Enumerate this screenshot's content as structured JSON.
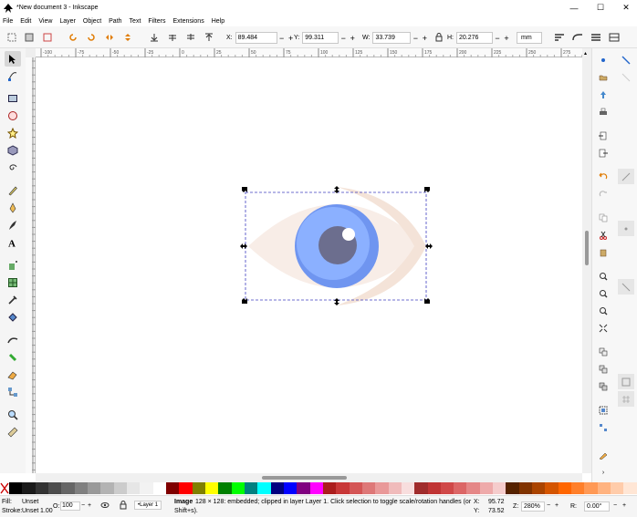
{
  "window": {
    "title": "*New document 3 - Inkscape",
    "minimize_glyph": "—",
    "maximize_glyph": "☐",
    "close_glyph": "✕"
  },
  "menu": [
    "File",
    "Edit",
    "View",
    "Layer",
    "Object",
    "Path",
    "Text",
    "Filters",
    "Extensions",
    "Help"
  ],
  "tool_controls": {
    "x_label": "X:",
    "x_value": "89.484",
    "y_label": "Y:",
    "y_value": "99.311",
    "w_label": "W:",
    "w_value": "33.739",
    "h_label": "H:",
    "h_value": "20.276",
    "unit": "mm",
    "minus": "−",
    "plus": "+"
  },
  "ruler_ticks": [
    "-100",
    "-75",
    "-50",
    "-25",
    "0",
    "25",
    "50",
    "75",
    "100",
    "125",
    "150",
    "175",
    "200",
    "225",
    "250",
    "275"
  ],
  "palette_colors": [
    "#000000",
    "#1a1a1a",
    "#333333",
    "#4d4d4d",
    "#666666",
    "#808080",
    "#999999",
    "#b3b3b3",
    "#cccccc",
    "#e6e6e6",
    "#f2f2f2",
    "#ffffff",
    "#800000",
    "#ff0000",
    "#808000",
    "#ffff00",
    "#008000",
    "#00ff00",
    "#008080",
    "#00ffff",
    "#000080",
    "#0000ff",
    "#800080",
    "#ff00ff",
    "#ab1d1d",
    "#c83737",
    "#d45555",
    "#de7878",
    "#e99999",
    "#f0bbbb",
    "#f8dede",
    "#a02c2c",
    "#c03434",
    "#d04848",
    "#dc6666",
    "#e58787",
    "#eeaaaa",
    "#f5cccc",
    "#552200",
    "#803300",
    "#aa4400",
    "#d45500",
    "#ff6600",
    "#ff7f2a",
    "#ff9955",
    "#ffb380",
    "#ffccaa",
    "#ffe6d5"
  ],
  "status": {
    "fill_label": "Fill:",
    "fill_value": "Unset",
    "stroke_label": "Stroke:",
    "stroke_value": "Unset",
    "stroke_width": "1.00",
    "opacity_label": "O:",
    "opacity_value": "100",
    "layer_name": "•Layer 1",
    "message_bold": "Image",
    "message_line1": " 128 × 128: embedded; clipped in layer Layer 1. Click selection to toggle scale/rotation handles (or",
    "message_line2": "Shift+s).",
    "cursor_x_label": "X:",
    "cursor_x": "95.72",
    "cursor_y_label": "Y:",
    "cursor_y": "73.52",
    "zoom_label": "Z:",
    "zoom_value": "280%",
    "rotate_label": "R:",
    "rotate_value": "0.00°"
  },
  "colors": {
    "eye_white": "#f8ede7",
    "iris_outer": "#6f95f0",
    "iris_inner": "#8bb0ff",
    "pupil": "#6c6e8e",
    "highlight": "#ffffff",
    "selection": "#4040c0"
  }
}
